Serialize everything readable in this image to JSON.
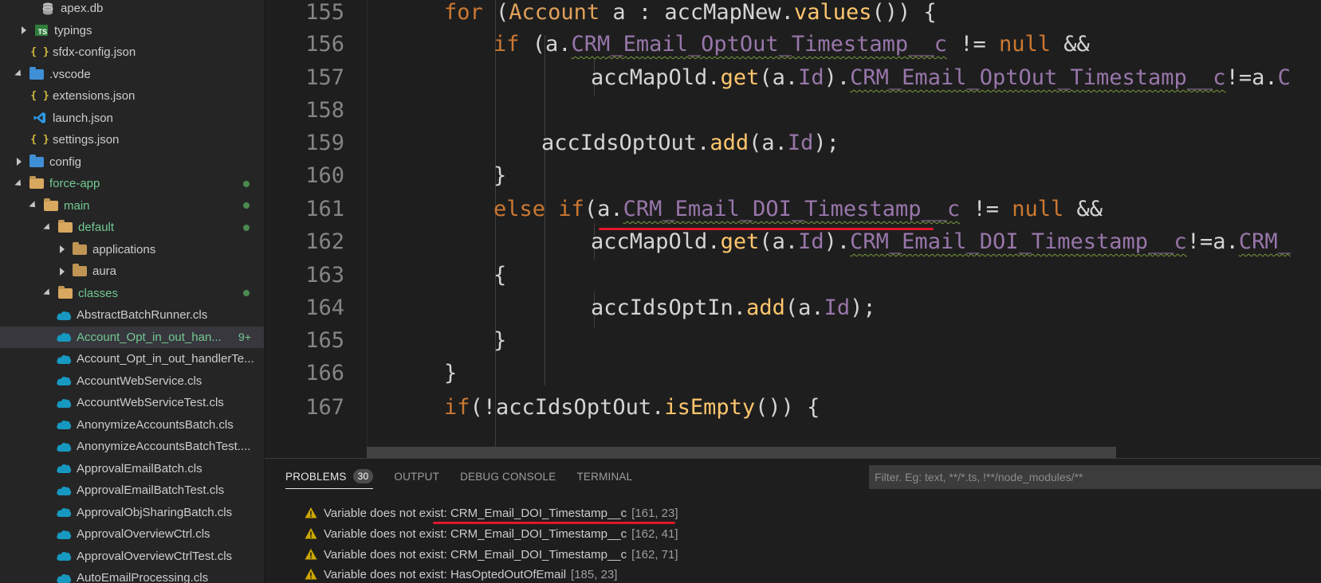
{
  "sidebar": {
    "items": [
      {
        "label": "apex.db",
        "icon": "database-icon",
        "twistie": "none",
        "git": false
      },
      {
        "label": "typings",
        "icon": "typescript-folder-icon",
        "twistie": "collapsed",
        "git": false
      },
      {
        "label": "sfdx-config.json",
        "icon": "json-icon",
        "twistie": "none",
        "git": false
      },
      {
        "label": ".vscode",
        "icon": "vscode-folder-icon",
        "twistie": "expanded",
        "git": false
      },
      {
        "label": "extensions.json",
        "icon": "json-icon",
        "twistie": "none",
        "git": false
      },
      {
        "label": "launch.json",
        "icon": "vscode-icon",
        "twistie": "none",
        "git": false
      },
      {
        "label": "settings.json",
        "icon": "json-icon",
        "twistie": "none",
        "git": false
      },
      {
        "label": "config",
        "icon": "config-folder-icon",
        "twistie": "collapsed",
        "git": false
      },
      {
        "label": "force-app",
        "icon": "folder-open-icon",
        "twistie": "expanded",
        "git": true
      },
      {
        "label": "main",
        "icon": "folder-open-icon",
        "twistie": "expanded",
        "git": true
      },
      {
        "label": "default",
        "icon": "folder-open-icon",
        "twistie": "expanded",
        "git": true
      },
      {
        "label": "applications",
        "icon": "folder-icon",
        "twistie": "collapsed",
        "git": false
      },
      {
        "label": "aura",
        "icon": "folder-icon",
        "twistie": "collapsed",
        "git": false
      },
      {
        "label": "classes",
        "icon": "folder-open-icon",
        "twistie": "expanded",
        "git": true
      },
      {
        "label": "AbstractBatchRunner.cls",
        "icon": "salesforce-cloud-icon",
        "twistie": "none",
        "git": false
      },
      {
        "label": "Account_Opt_in_out_han...",
        "icon": "salesforce-cloud-icon",
        "twistie": "none",
        "git": true,
        "badge": "9+",
        "selected": true
      },
      {
        "label": "Account_Opt_in_out_handlerTe...",
        "icon": "salesforce-cloud-icon",
        "twistie": "none",
        "git": false
      },
      {
        "label": "AccountWebService.cls",
        "icon": "salesforce-cloud-icon",
        "twistie": "none",
        "git": false
      },
      {
        "label": "AccountWebServiceTest.cls",
        "icon": "salesforce-cloud-icon",
        "twistie": "none",
        "git": false
      },
      {
        "label": "AnonymizeAccountsBatch.cls",
        "icon": "salesforce-cloud-icon",
        "twistie": "none",
        "git": false
      },
      {
        "label": "AnonymizeAccountsBatchTest....",
        "icon": "salesforce-cloud-icon",
        "twistie": "none",
        "git": false
      },
      {
        "label": "ApprovalEmailBatch.cls",
        "icon": "salesforce-cloud-icon",
        "twistie": "none",
        "git": false
      },
      {
        "label": "ApprovalEmailBatchTest.cls",
        "icon": "salesforce-cloud-icon",
        "twistie": "none",
        "git": false
      },
      {
        "label": "ApprovalObjSharingBatch.cls",
        "icon": "salesforce-cloud-icon",
        "twistie": "none",
        "git": false
      },
      {
        "label": "ApprovalOverviewCtrl.cls",
        "icon": "salesforce-cloud-icon",
        "twistie": "none",
        "git": false
      },
      {
        "label": "ApprovalOverviewCtrlTest.cls",
        "icon": "salesforce-cloud-icon",
        "twistie": "none",
        "git": false
      },
      {
        "label": "AutoEmailProcessing.cls",
        "icon": "salesforce-cloud-icon",
        "twistie": "none",
        "git": false
      }
    ]
  },
  "editor": {
    "line_numbers": [
      "155",
      "156",
      "157",
      "158",
      "159",
      "160",
      "161",
      "162",
      "163",
      "164",
      "165",
      "166",
      "167"
    ],
    "code": {
      "l155": {
        "kw_for": "for",
        "t1": " (",
        "ty": "Account",
        "t2": " a : accMapNew.",
        "fn": "values",
        "t3": "()) {"
      },
      "l156": {
        "kw_if": "if",
        "t1": " (a.",
        "fld": "CRM_Email_OptOut_Timestamp__c",
        "t2": " != ",
        "nul": "null",
        "t3": " &&"
      },
      "l157": {
        "t1": "accMapOld.",
        "fn": "get",
        "t2": "(a.",
        "fld1": "Id",
        "t3": ").",
        "fld2": "CRM_Email_OptOut_Timestamp__c",
        "t4": "!=a.",
        "fld3": "C"
      },
      "l159": {
        "t1": "accIdsOptOut.",
        "fn": "add",
        "t2": "(a.",
        "fld": "Id",
        "t3": ");"
      },
      "l160": {
        "t1": "}"
      },
      "l161": {
        "kw_else": "else",
        "t0": " ",
        "kw_if": "if",
        "t1": "(a.",
        "fld": "CRM_Email_DOI_Timestamp__c",
        "t2": " != ",
        "nul": "null",
        "t3": " &&"
      },
      "l162": {
        "t1": "accMapOld.",
        "fn": "get",
        "t2": "(a.",
        "fld1": "Id",
        "t3": ").",
        "fld2": "CRM_Email_DOI_Timestamp__c",
        "t4": "!=a.",
        "fld3": "CRM_"
      },
      "l163": {
        "t1": "{"
      },
      "l164": {
        "t1": "accIdsOptIn.",
        "fn": "add",
        "t2": "(a.",
        "fld": "Id",
        "t3": ");"
      },
      "l165": {
        "t1": "}"
      },
      "l166": {
        "t1": "}"
      },
      "l167": {
        "kw_if": "if",
        "t1": "(!accIdsOptOut.",
        "fn": "isEmpty",
        "t2": "()) {"
      }
    }
  },
  "panel": {
    "tabs": [
      {
        "label": "PROBLEMS",
        "active": true
      },
      {
        "label": "OUTPUT",
        "active": false
      },
      {
        "label": "DEBUG CONSOLE",
        "active": false
      },
      {
        "label": "TERMINAL",
        "active": false
      }
    ],
    "problems_count": "30",
    "filter_placeholder": "Filter. Eg: text, **/*.ts, !**/node_modules/**",
    "problems": [
      {
        "message": "Variable does not exist: CRM_Email_DOI_Timestamp__c",
        "location": "[161, 23]"
      },
      {
        "message": "Variable does not exist: CRM_Email_DOI_Timestamp__c",
        "location": "[162, 41]"
      },
      {
        "message": "Variable does not exist: CRM_Email_DOI_Timestamp__c",
        "location": "[162, 71]"
      },
      {
        "message": "Variable does not exist: HasOptedOutOfEmail",
        "location": "[185, 23]"
      }
    ]
  },
  "colors": {
    "keyword": "#cc7832",
    "method": "#ffc66d",
    "field": "#9876aa",
    "annotation_red": "#e0162b",
    "git_modified": "#73c991",
    "warning": "#cca700"
  }
}
